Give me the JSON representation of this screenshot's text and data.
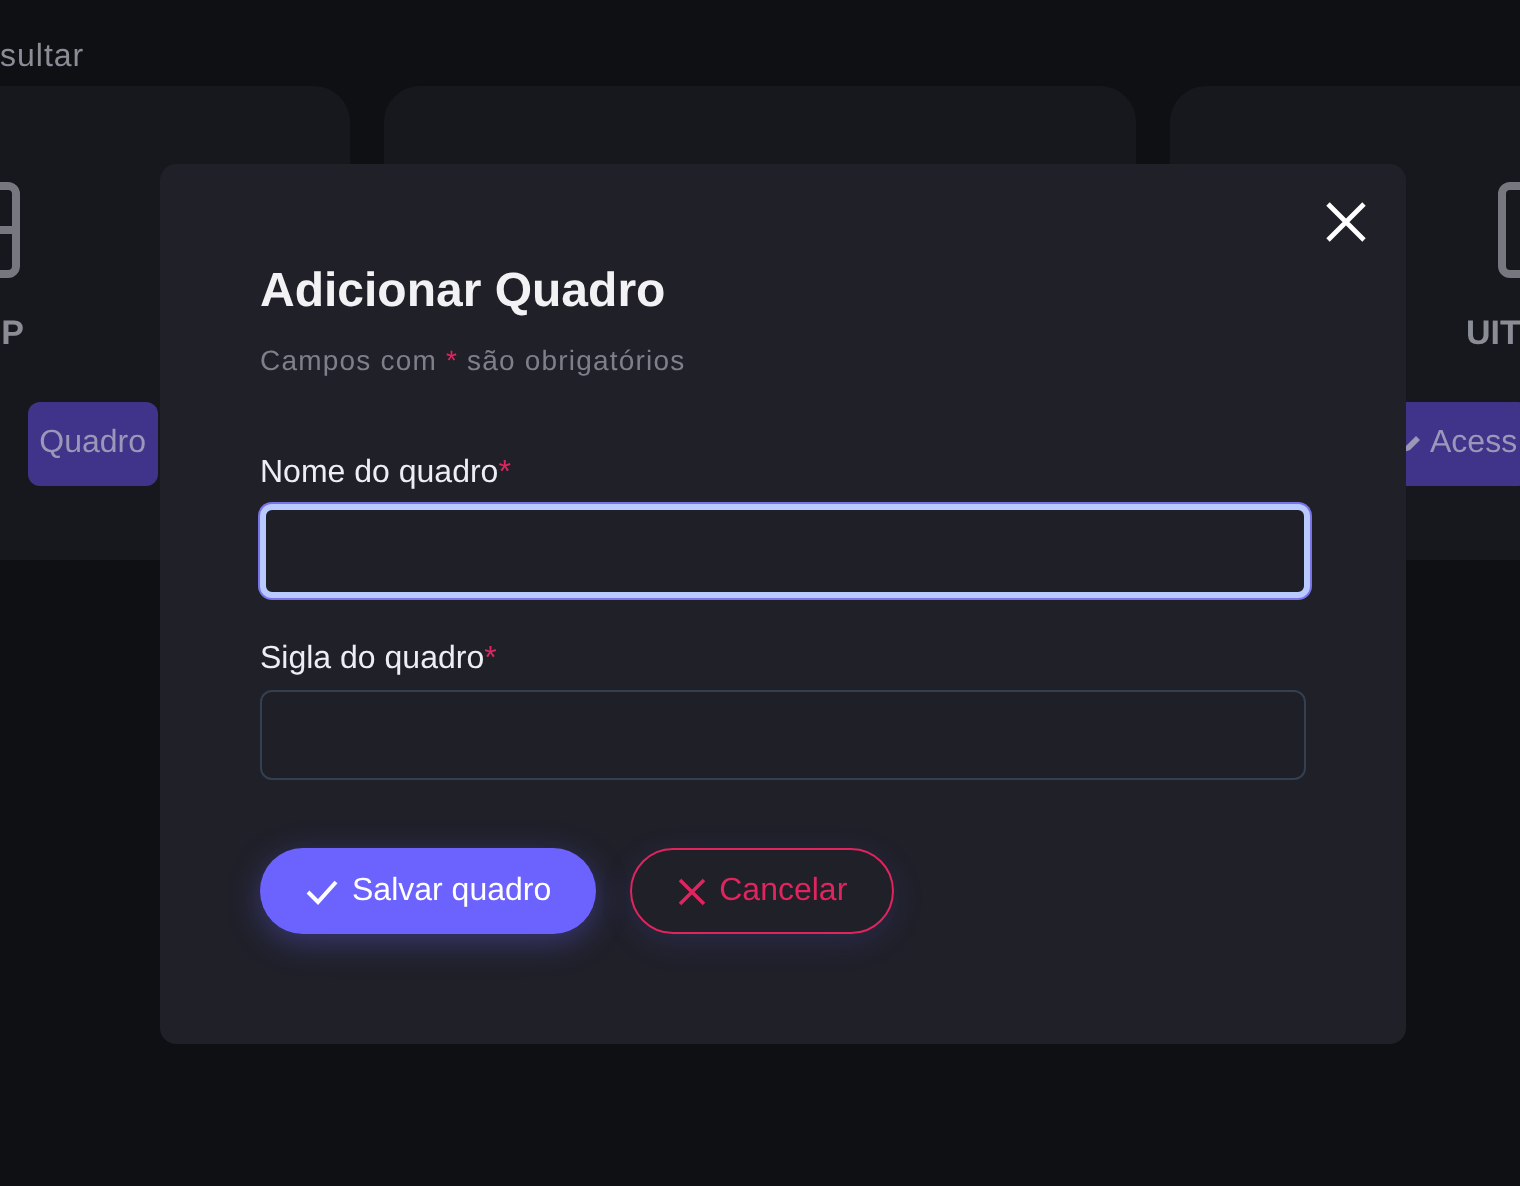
{
  "background": {
    "header_text": "sultar",
    "left_card": {
      "title": "P",
      "button": "Quadro"
    },
    "right_card": {
      "title": "UIT",
      "button": "Acess"
    }
  },
  "dialog": {
    "title": "Adicionar Quadro",
    "subtitle": {
      "before": "Campos com",
      "mark": "*",
      "after": "são obrigatórios"
    },
    "fields": [
      {
        "label": "Nome do quadro",
        "required_mark": "*",
        "focused": true
      },
      {
        "label": "Sigla do quadro",
        "required_mark": "*",
        "focused": false
      }
    ],
    "buttons": [
      {
        "kind": "primary",
        "label": "Salvar quadro"
      },
      {
        "kind": "danger",
        "label": "Cancelar"
      }
    ]
  }
}
